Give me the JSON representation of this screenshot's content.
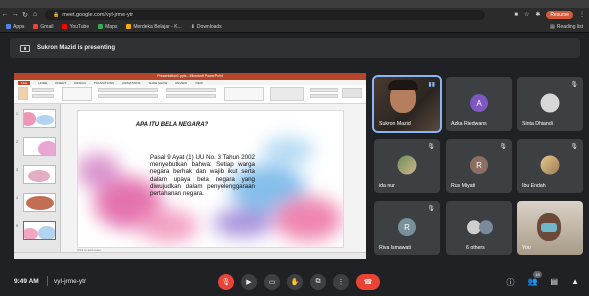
{
  "browser": {
    "url": "meet.google.com/vyl-jrme-ytr",
    "resume_label": "Resume",
    "bookmarks": [
      {
        "label": "Apps",
        "color": "#4a86e8"
      },
      {
        "label": "Gmail",
        "color": "#ea4335"
      },
      {
        "label": "YouTube",
        "color": "#ff0000"
      },
      {
        "label": "Maps",
        "color": "#34a853"
      },
      {
        "label": "Merdeka Belajar - K...",
        "color": "#f9ab00"
      },
      {
        "label": "Downloads",
        "color": "#cfcfcf"
      }
    ],
    "reading_list": "Reading list"
  },
  "banner": {
    "text": "Sukron Mazid is presenting"
  },
  "presentation": {
    "window_title": "Presentation1.pptx - Microsoft PowerPoint",
    "tabs": [
      "FILE",
      "HOME",
      "INSERT",
      "DESIGN",
      "TRANSITIONS",
      "ANIMATIONS",
      "SLIDE SHOW",
      "REVIEW",
      "VIEW"
    ],
    "slide_title": "APA ITU BELA NEGARA?",
    "slide_body": "Pasal 9 Ayat (1) UU No. 3 Tahun 2002 menyebutkan bahwa: Setiap warga negara berhak dan wajib ikut serta dalam upaya bela negara yang diwujudkan dalam penyelenggaraan pertahanan negara.",
    "notes_placeholder": "Click to add notes",
    "thumb_numbers": [
      "1",
      "2",
      "3",
      "4",
      "5"
    ]
  },
  "participants": [
    {
      "name": "Sukron Mazid",
      "type": "photo",
      "active": true
    },
    {
      "name": "Azka Riedwans",
      "type": "initial",
      "initial": "A",
      "color": "#7e57c2"
    },
    {
      "name": "Sinta Dhiandi",
      "type": "photo"
    },
    {
      "name": "ida nur",
      "type": "photo"
    },
    {
      "name": "Rus Miyati",
      "type": "initial",
      "initial": "R",
      "color": "#8d6e63"
    },
    {
      "name": "Ibu Endah",
      "type": "photo"
    },
    {
      "name": "Riva lsmawati",
      "type": "initial",
      "initial": "R",
      "color": "#78909c"
    },
    {
      "name": "6 others",
      "type": "group"
    },
    {
      "name": "You",
      "type": "photo"
    }
  ],
  "meeting": {
    "time": "9:49 AM",
    "code": "vyl-jrme-ytr",
    "participant_count": "15"
  },
  "colors": {
    "end_call": "#ea4335",
    "background": "#202124",
    "tile": "#3c4043"
  }
}
